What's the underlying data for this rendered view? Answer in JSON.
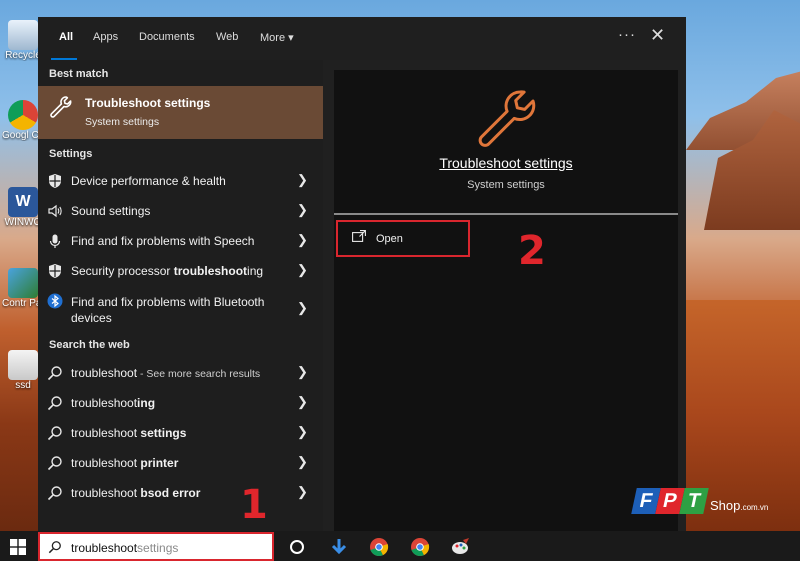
{
  "desktop": {
    "icons": [
      {
        "label": "Recycle",
        "name": "recycle-bin-icon"
      },
      {
        "label": "Googl Chron",
        "name": "chrome-desktop-icon"
      },
      {
        "label": "WINWO",
        "name": "word-desktop-icon"
      },
      {
        "label": "Contr Pane",
        "name": "control-panel-desktop-icon"
      },
      {
        "label": "ssd",
        "name": "ssd-desktop-icon"
      }
    ]
  },
  "tabs": {
    "all": "All",
    "apps": "Apps",
    "documents": "Documents",
    "web": "Web",
    "more": "More ▾",
    "dots": "···",
    "close": "✕"
  },
  "best_match": {
    "header": "Best match",
    "title": "Troubleshoot settings",
    "subtitle": "System settings"
  },
  "settings": {
    "header": "Settings",
    "items": [
      {
        "pre": "Device performance & health",
        "bold": "",
        "post": ""
      },
      {
        "pre": "Sound settings",
        "bold": "",
        "post": ""
      },
      {
        "pre": "Find and fix problems with Speech",
        "bold": "",
        "post": ""
      },
      {
        "pre": "Security processor ",
        "bold": "troubleshoot",
        "post": "ing"
      },
      {
        "line1": "Find and fix problems with Bluetooth",
        "line2": "devices"
      }
    ]
  },
  "web": {
    "header": "Search the web",
    "items": [
      {
        "pre": "troubleshoot",
        "bold": "",
        "small": " - See more search results"
      },
      {
        "pre": "troubleshoot",
        "bold": "ing",
        "small": ""
      },
      {
        "pre": "troubleshoot ",
        "bold": "settings",
        "small": ""
      },
      {
        "pre": "troubleshoot ",
        "bold": "printer",
        "small": ""
      },
      {
        "pre": "troubleshoot ",
        "bold": "bsod error",
        "small": ""
      }
    ]
  },
  "preview": {
    "title": "Troubleshoot settings",
    "subtitle": "System settings",
    "open_label": "Open"
  },
  "annotations": {
    "step1": "1",
    "step2": "2"
  },
  "search": {
    "typed": "troubleshoot",
    "suggestion": "settings"
  },
  "brand": {
    "letters": [
      "F",
      "P",
      "T"
    ],
    "shop": "Shop",
    "domain": ".com.vn"
  },
  "colors": {
    "accent": "#0078d7",
    "highlight": "#6a4a35",
    "annotation_red": "#d9262e",
    "wrench_orange": "#e0763a"
  }
}
